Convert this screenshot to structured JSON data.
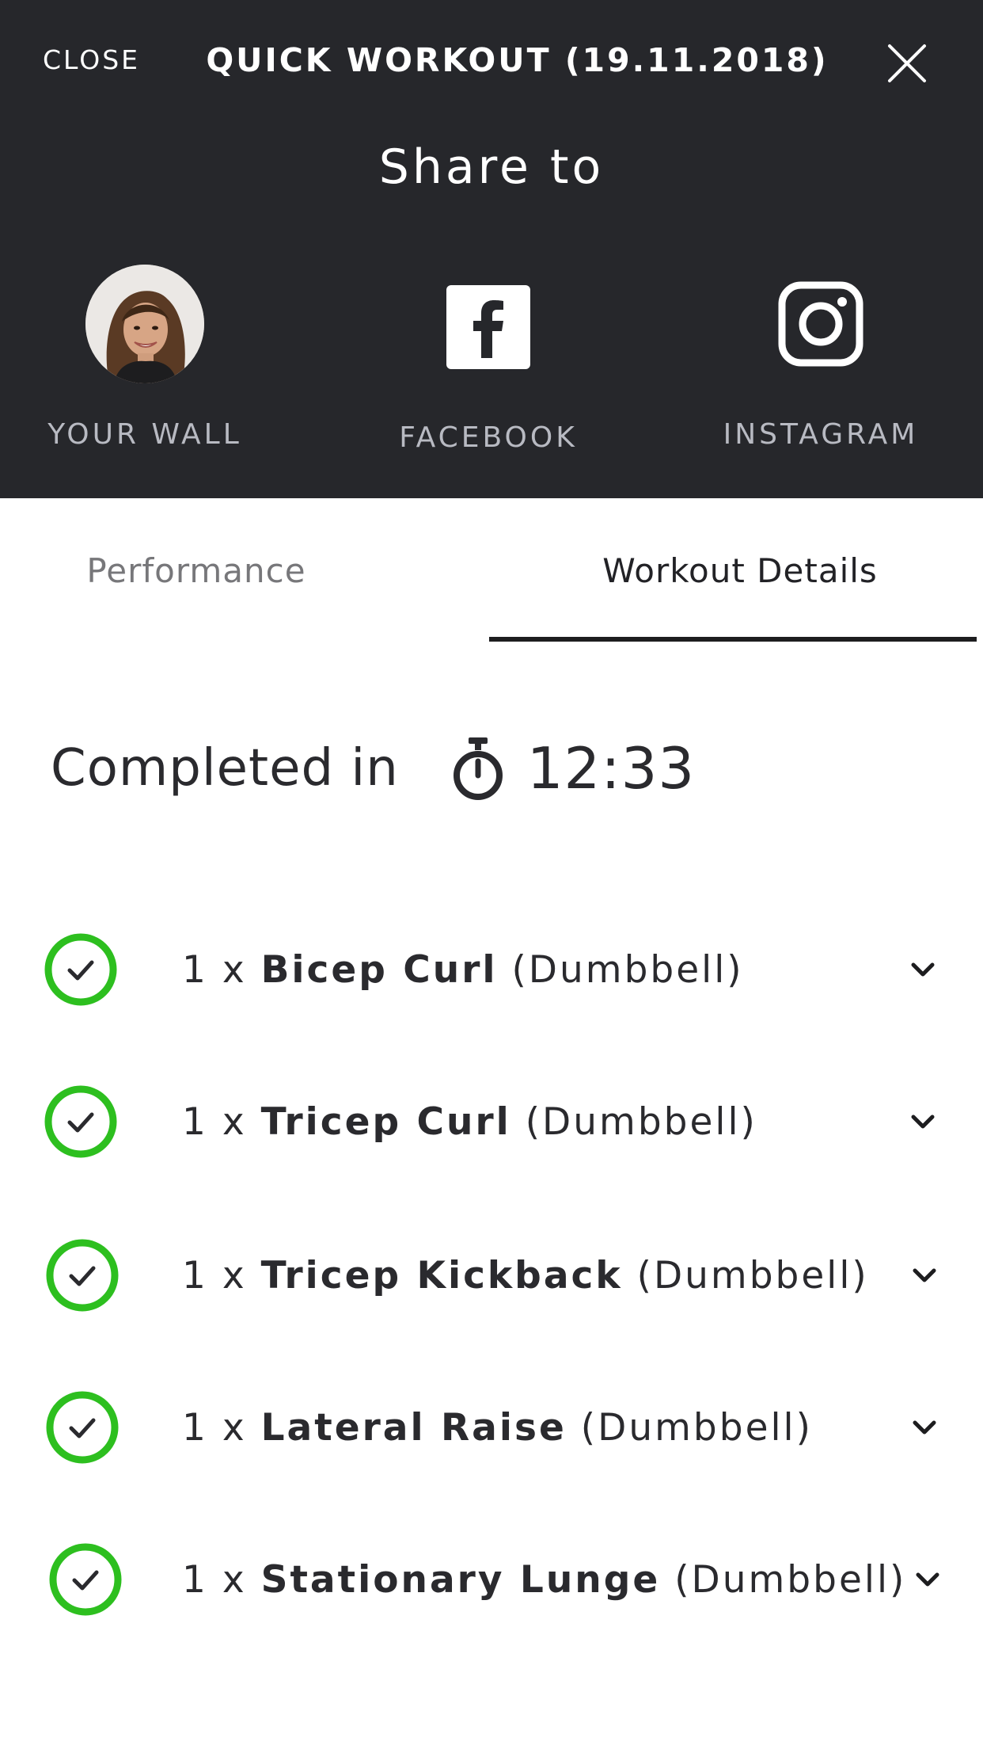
{
  "header": {
    "close_label": "CLOSE",
    "title": "QUICK WORKOUT (19.11.2018)",
    "share_heading": "Share to",
    "background": "#26272b"
  },
  "share_options": [
    {
      "label": "YOUR WALL",
      "icon": "avatar"
    },
    {
      "label": "FACEBOOK",
      "icon": "facebook-icon"
    },
    {
      "label": "INSTAGRAM",
      "icon": "instagram-icon"
    }
  ],
  "tabs": [
    {
      "label": "Performance",
      "active": false
    },
    {
      "label": "Workout Details",
      "active": true
    }
  ],
  "summary": {
    "completed_label": "Completed in",
    "time": "12:33",
    "icon": "stopwatch-icon"
  },
  "exercises": [
    {
      "count": "1 x ",
      "name": "Bicep Curl",
      "equipment": " (Dumbbell)",
      "done": true
    },
    {
      "count": "1 x ",
      "name": "Tricep Curl",
      "equipment": " (Dumbbell)",
      "done": true
    },
    {
      "count": "1 x ",
      "name": "Tricep Kickback",
      "equipment": " (Dumbbell)",
      "done": true
    },
    {
      "count": "1 x ",
      "name": "Lateral Raise",
      "equipment": " (Dumbbell)",
      "done": true
    },
    {
      "count": "1 x ",
      "name": "Stationary Lunge",
      "equipment": " (Dumbbell)",
      "done": true
    }
  ],
  "colors": {
    "check_green": "#2dbf1f",
    "tab_underline": "#1d1d1f",
    "muted_label": "#b8bac2"
  }
}
